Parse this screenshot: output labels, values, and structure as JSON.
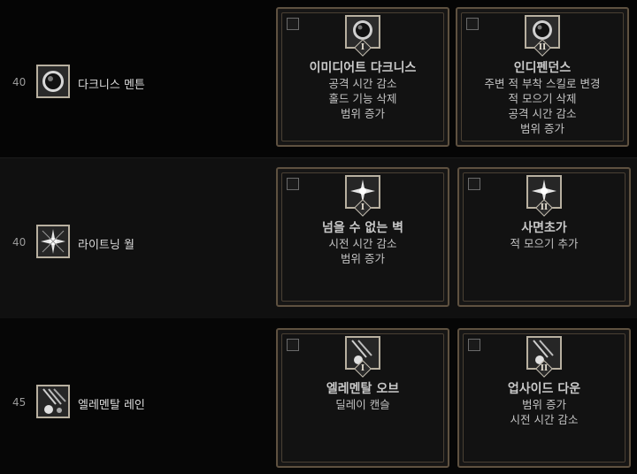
{
  "rows": [
    {
      "level": "40",
      "skill": {
        "name": "다크니스 멘튼",
        "icon": "dark-orb-icon"
      },
      "augments": [
        {
          "numeral": "I",
          "title": "이미디어트 다크니스",
          "lines": [
            "공격 시간 감소",
            "홀드 기능 삭제",
            "범위 증가"
          ],
          "icon": "dark-orb-icon"
        },
        {
          "numeral": "II",
          "title": "인디펜던스",
          "lines": [
            "주변 적 부착 스킬로 변경",
            "적 모으기 삭제",
            "공격 시간 감소",
            "범위 증가"
          ],
          "icon": "dark-orb-icon"
        }
      ]
    },
    {
      "level": "40",
      "skill": {
        "name": "라이트닝 월",
        "icon": "lightning-burst-icon"
      },
      "augments": [
        {
          "numeral": "I",
          "title": "넘을 수 없는 벽",
          "lines": [
            "시전 시간 감소",
            "범위 증가"
          ],
          "icon": "lightning-burst-icon"
        },
        {
          "numeral": "II",
          "title": "사면초가",
          "lines": [
            "적 모으기 추가"
          ],
          "icon": "lightning-burst-icon"
        }
      ]
    },
    {
      "level": "45",
      "skill": {
        "name": "엘레멘탈 레인",
        "icon": "elemental-rain-icon"
      },
      "augments": [
        {
          "numeral": "I",
          "title": "엘레멘탈 오브",
          "lines": [
            "딜레이 캔슬"
          ],
          "icon": "elemental-rain-icon"
        },
        {
          "numeral": "II",
          "title": "업사이드 다운",
          "lines": [
            "범위 증가",
            "시전 시간 감소"
          ],
          "icon": "elemental-rain-icon"
        }
      ]
    }
  ]
}
